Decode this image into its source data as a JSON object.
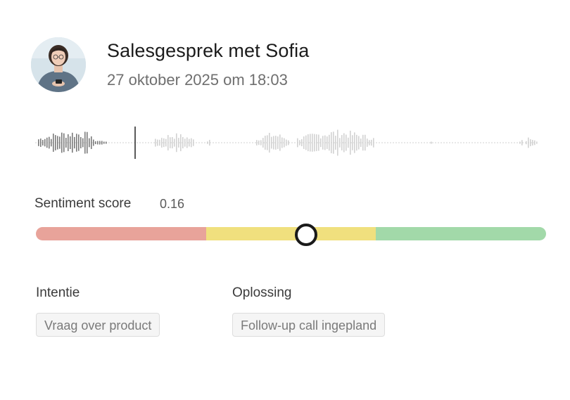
{
  "call": {
    "title": "Salesgesprek met Sofia",
    "datetime": "27 oktober 2025 om 18:03"
  },
  "sentiment": {
    "label": "Sentiment score",
    "value": "0.16",
    "position_fraction": 0.53,
    "colors": {
      "negative": "#e8a39a",
      "neutral": "#f0e07e",
      "positive": "#a2d9a9"
    }
  },
  "intent": {
    "label": "Intentie",
    "tag": "Vraag over product"
  },
  "resolution": {
    "label": "Oplossing",
    "tag": "Follow-up call ingepland"
  },
  "audio": {
    "played_color": "#7b7b7b",
    "unplayed_color": "#d2d2d2"
  }
}
